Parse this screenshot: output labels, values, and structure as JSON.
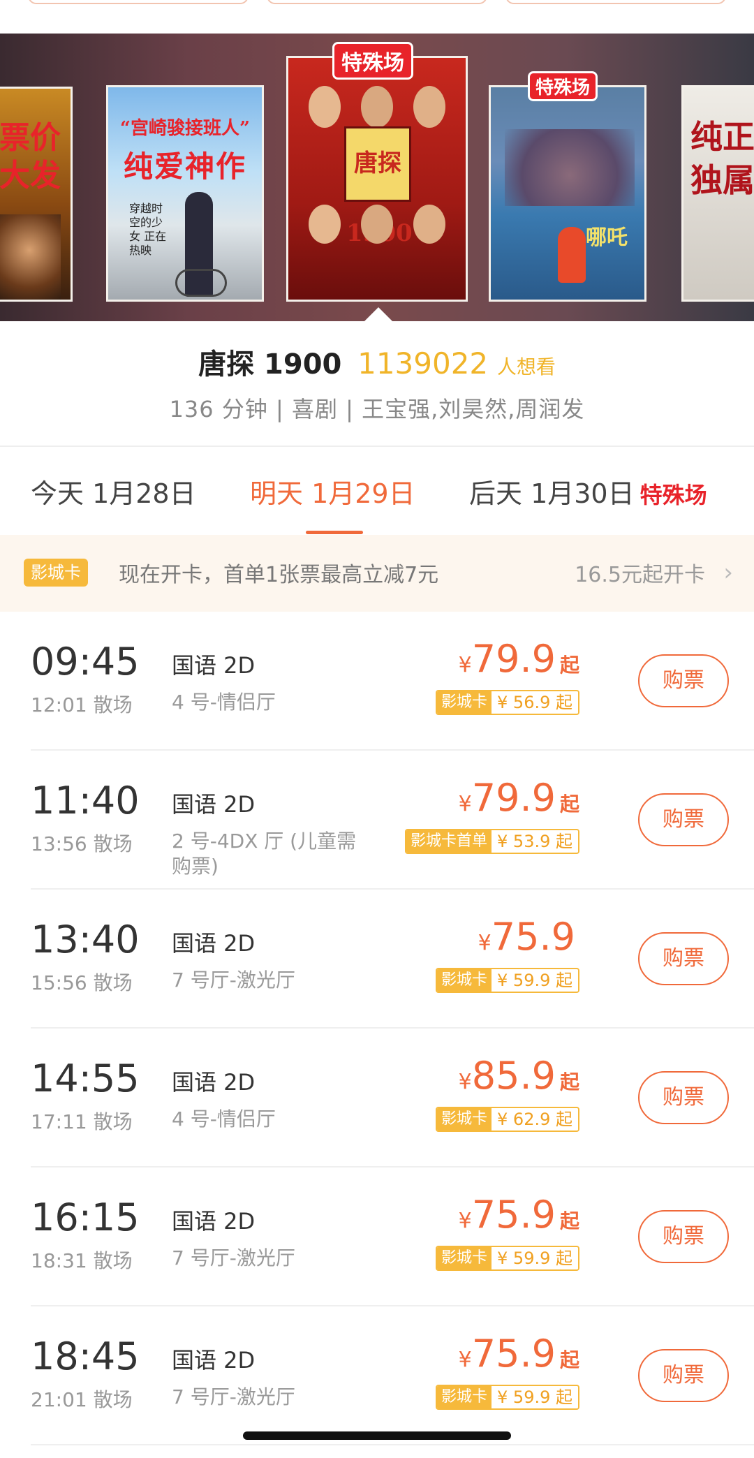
{
  "posters": [
    {
      "title_lines": [
        "票价",
        "大发"
      ],
      "tag": ""
    },
    {
      "headline": "“宫崎骏接班人”",
      "title": "纯爱神作",
      "tagline": "穿越时空的少女 正在热映",
      "tag": ""
    },
    {
      "title": "唐探1900",
      "tag": "特殊场"
    },
    {
      "title": "哪吒",
      "tag": "特殊场"
    },
    {
      "title_lines": [
        "纯正",
        "独属"
      ],
      "tag": ""
    }
  ],
  "movie": {
    "title": "唐探 1900",
    "want_count": "1139022",
    "want_label": "人想看",
    "meta": "136 分钟 | 喜剧 | 王宝强,刘昊然,周润发"
  },
  "date_tabs": [
    {
      "label": "今天 1月28日"
    },
    {
      "label": "明天 1月29日",
      "active": true
    },
    {
      "label": "后天 1月30日",
      "special": "特殊场"
    }
  ],
  "card_banner": {
    "badge": "影城卡",
    "text": "现在开卡，首单1张票最高立减7元",
    "price": "16.5元起开卡"
  },
  "showtimes": [
    {
      "start": "09:45",
      "end": "12:01 散场",
      "lang": "国语 2D",
      "hall": "4 号-情侣厅",
      "yen": "¥",
      "price": "79.9",
      "qi": "起",
      "card_label": "影城卡",
      "card_price": "¥ 56.9 起",
      "buy": "购票"
    },
    {
      "start": "11:40",
      "end": "13:56 散场",
      "lang": "国语 2D",
      "hall": "2 号-4DX 厅 (儿童需购票)",
      "yen": "¥",
      "price": "79.9",
      "qi": "起",
      "card_label": "影城卡首单",
      "card_price": "¥ 53.9 起",
      "buy": "购票"
    },
    {
      "start": "13:40",
      "end": "15:56 散场",
      "lang": "国语 2D",
      "hall": "7 号厅-激光厅",
      "yen": "¥",
      "price": "75.9",
      "qi": "",
      "card_label": "影城卡",
      "card_price": "¥ 59.9 起",
      "buy": "购票"
    },
    {
      "start": "14:55",
      "end": "17:11 散场",
      "lang": "国语 2D",
      "hall": "4 号-情侣厅",
      "yen": "¥",
      "price": "85.9",
      "qi": "起",
      "card_label": "影城卡",
      "card_price": "¥ 62.9 起",
      "buy": "购票"
    },
    {
      "start": "16:15",
      "end": "18:31 散场",
      "lang": "国语 2D",
      "hall": "7 号厅-激光厅",
      "yen": "¥",
      "price": "75.9",
      "qi": "起",
      "card_label": "影城卡",
      "card_price": "¥ 59.9 起",
      "buy": "购票"
    },
    {
      "start": "18:45",
      "end": "21:01 散场",
      "lang": "国语 2D",
      "hall": "7 号厅-激光厅",
      "yen": "¥",
      "price": "75.9",
      "qi": "起",
      "card_label": "影城卡",
      "card_price": "¥ 59.9 起",
      "buy": "购票"
    }
  ],
  "colors": {
    "accent": "#f0693a",
    "want": "#f0b429",
    "card_gold": "#f6b93b",
    "special_red": "#e8232a"
  }
}
